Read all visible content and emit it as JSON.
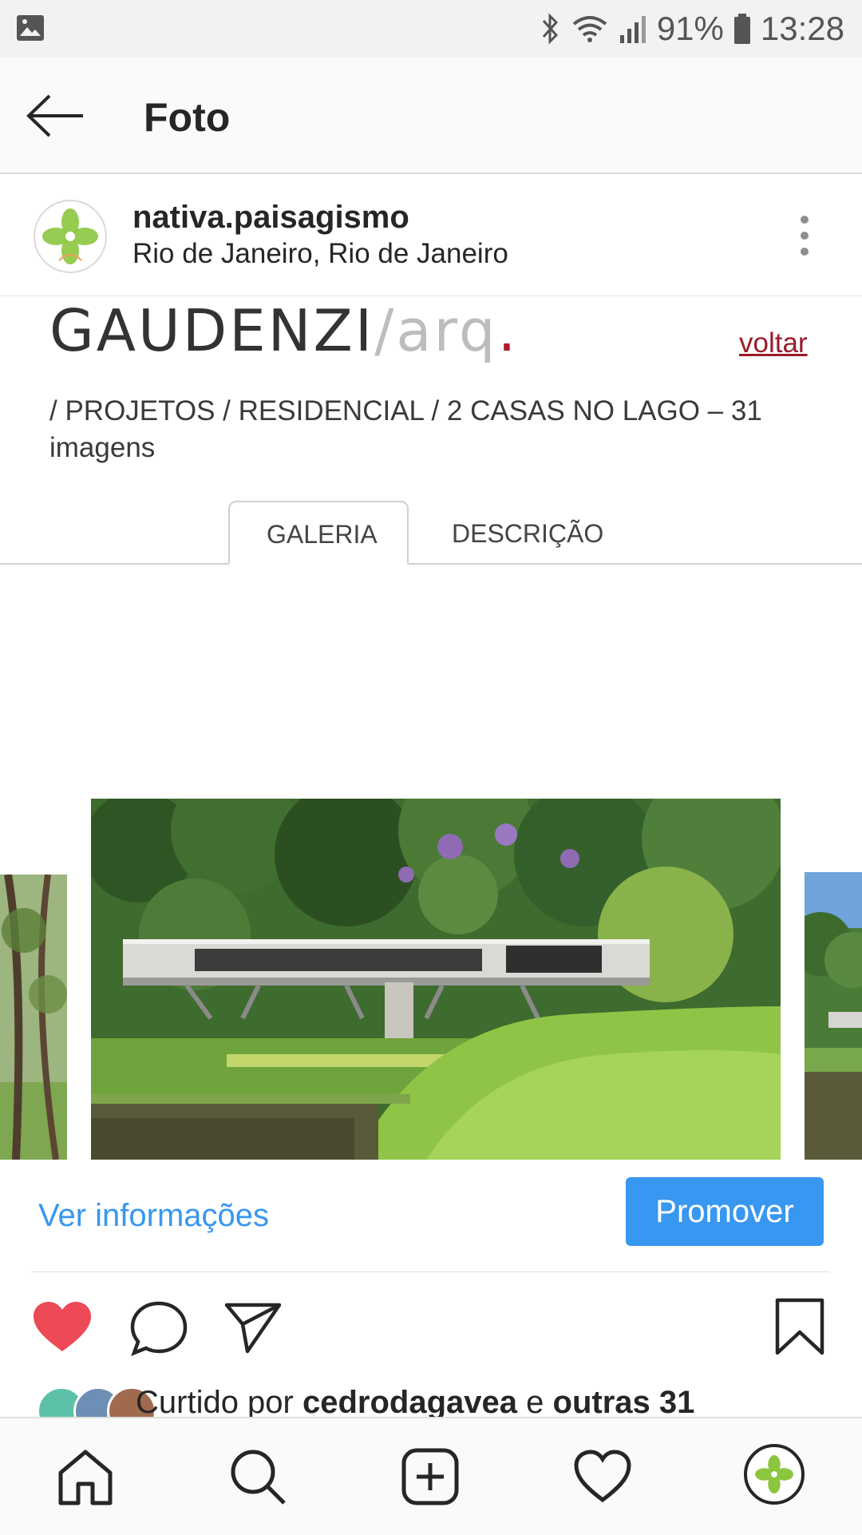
{
  "status_bar": {
    "battery": "91%",
    "time": "13:28"
  },
  "app_bar": {
    "title": "Foto"
  },
  "post": {
    "username": "nativa.paisagismo",
    "location": "Rio de Janeiro, Rio de Janeiro"
  },
  "website": {
    "logo_main": "GAUDENZI",
    "logo_suffix": "/arq",
    "logo_dot": ".",
    "back_link": "voltar",
    "breadcrumb": "/ PROJETOS / RESIDENCIAL / 2 CASAS NO LAGO – 31 imagens",
    "tabs": [
      {
        "label": "GALERIA"
      },
      {
        "label": "DESCRIÇÃO"
      }
    ]
  },
  "actions": {
    "view_info": "Ver informações",
    "promote": "Promover",
    "liked_prefix": "Curtido por",
    "liked_user": "cedrodagavea",
    "liked_joiner": "e",
    "liked_others": "outras 31"
  },
  "colors": {
    "accent": "#3897f0",
    "like": "#ed4956",
    "brand_red": "#b2182b"
  },
  "icons": [
    "gallery-icon",
    "bluetooth-icon",
    "wifi-icon",
    "signal-icon",
    "battery-icon",
    "back-arrow-icon",
    "more-vertical-icon",
    "heart-icon",
    "comment-icon",
    "share-icon",
    "bookmark-icon",
    "home-icon",
    "search-icon",
    "add-icon",
    "activity-icon",
    "profile-icon"
  ]
}
